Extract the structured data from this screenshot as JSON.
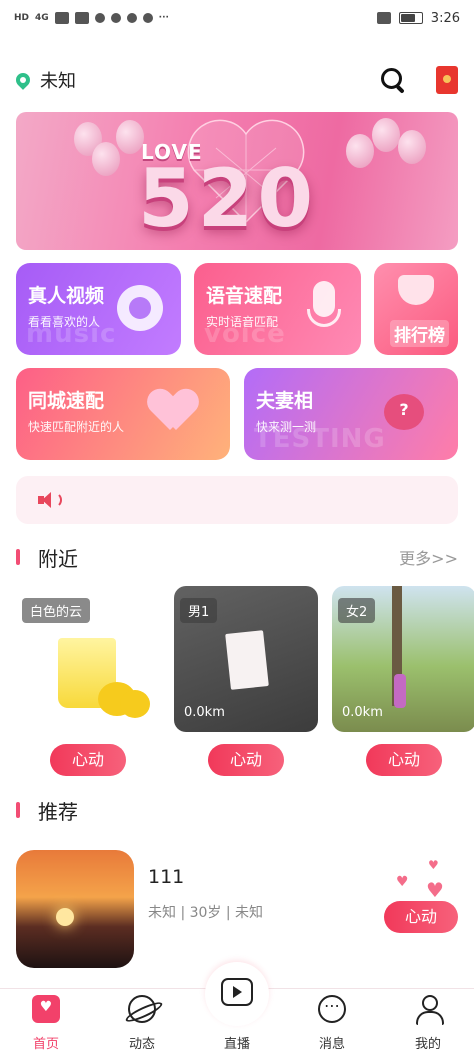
{
  "status_bar": {
    "time": "3:26",
    "network": "HD",
    "signal": "4G"
  },
  "header": {
    "location": "未知"
  },
  "banner": {
    "heading": "LOVE",
    "number": "520"
  },
  "features": {
    "video": {
      "title": "真人视频",
      "subtitle": "看看喜欢的人",
      "watermark": "music"
    },
    "voice": {
      "title": "语音速配",
      "subtitle": "实时语音匹配",
      "watermark": "voice"
    },
    "rank": {
      "title": "排行榜"
    },
    "city": {
      "title": "同城速配",
      "subtitle": "快速匹配附近的人"
    },
    "couple": {
      "title": "夫妻相",
      "subtitle": "快来测一测",
      "watermark": "TESTING"
    }
  },
  "nearby": {
    "title": "附近",
    "more": "更多>>",
    "items": [
      {
        "name": "白色的云",
        "distance": "",
        "button": "心动"
      },
      {
        "name": "男1",
        "distance": "0.0km",
        "button": "心动"
      },
      {
        "name": "女2",
        "distance": "0.0km",
        "button": "心动"
      }
    ]
  },
  "recommend": {
    "title": "推荐",
    "item": {
      "name": "111",
      "meta": "未知 | 30岁 | 未知",
      "button": "心动"
    }
  },
  "tabbar": {
    "items": [
      {
        "label": "首页",
        "icon": "home-icon",
        "active": true
      },
      {
        "label": "动态",
        "icon": "planet-icon",
        "active": false
      },
      {
        "label": "直播",
        "icon": "tv-icon",
        "active": false
      },
      {
        "label": "消息",
        "icon": "message-icon",
        "active": false
      },
      {
        "label": "我的",
        "icon": "user-icon",
        "active": false
      }
    ]
  },
  "colors": {
    "accent": "#f2416a",
    "location_dot": "#2fc08a"
  }
}
